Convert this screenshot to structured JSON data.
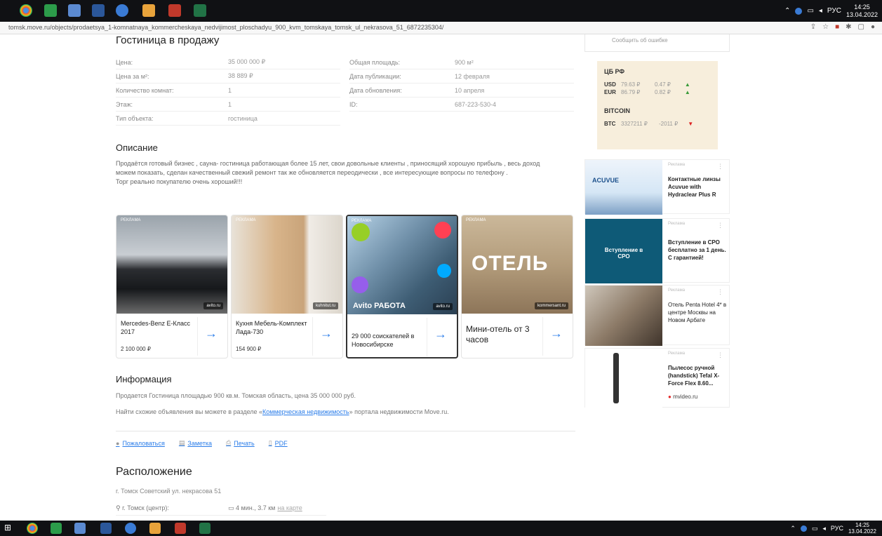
{
  "browser": {
    "url": "tomsk.move.ru/objects/prodaetsya_1-komnatnaya_kommercheskaya_nedvijimost_ploschadyu_900_kvm_tomskaya_tomsk_ul_nekrasova_51_6872235304/",
    "language": "РУС",
    "time": "14:25",
    "date": "13.04.2022"
  },
  "taskbar": {
    "language": "РУС",
    "time": "14:25",
    "date": "13.04.2022"
  },
  "listing": {
    "title": "Гостиница в продажу",
    "props_left": [
      {
        "label": "Цена:",
        "value": "35 000 000 ₽"
      },
      {
        "label": "Цена за м²:",
        "value": "38 889 ₽"
      },
      {
        "label": "Количество комнат:",
        "value": "1"
      },
      {
        "label": "Этаж:",
        "value": "1"
      },
      {
        "label": "Тип объекта:",
        "value": "гостиница"
      }
    ],
    "props_right": [
      {
        "label": "Общая площадь:",
        "value": "900 м²"
      },
      {
        "label": "Дата публикации:",
        "value": "12 февраля"
      },
      {
        "label": "Дата обновления:",
        "value": "10 апреля"
      },
      {
        "label": "ID:",
        "value": "687-223-530-4"
      }
    ],
    "description_title": "Описание",
    "description": "Продаётся готовый бизнес , сауна- гостиница работающая более 15 лет, свои довольные клиенты , приносящий хорошую прибыль , весь доход можем показать, сделан качественный свежий ремонт так же обновляется переодически , все интересующие вопросы по телефону .",
    "description_extra": "Торг реально покупателю очень хороший!!!"
  },
  "cards": [
    {
      "ad_label": "РЕКЛАМА",
      "source": "avito.ru",
      "caption": "Mercedes-Benz E-Класс 2017",
      "price": "2 100 000 ₽"
    },
    {
      "ad_label": "РЕКЛАМА",
      "source": "kuhnitut.ru",
      "caption": "Кухня Мебель-Комплект Лада-730",
      "price": "154 900 ₽"
    },
    {
      "ad_label": "РЕКЛАМА",
      "source": "avito.ru",
      "banner": "Avito РАБОТА",
      "caption": "29 000 соискателей в Новосибирске",
      "price": ""
    },
    {
      "ad_label": "РЕКЛАМА",
      "source": "kommersant.ru",
      "banner": "ОТЕЛЬ",
      "caption": "Мини-отель от 3 часов",
      "price": ""
    }
  ],
  "info": {
    "title": "Информация",
    "line1": "Продается Гостиница площадью 900 кв.м. Томская область, цена 35 000 000 руб.",
    "line2_before": "Найти схожие объявления вы можете в разделе «",
    "line2_link": "Коммерческая недвижимость",
    "line2_after": "» портала недвижимости Move.ru."
  },
  "actions": {
    "complain": "Пожаловаться",
    "note": "Заметка",
    "print": "Печать",
    "pdf": "PDF"
  },
  "location": {
    "title": "Расположение",
    "address": "г. Томск Советский ул. некрасова 51",
    "place": "г. Томск (центр):",
    "distance": "4 мин., 3.7 км",
    "map_link": "на карте"
  },
  "sidebar": {
    "top_text": "Сообщить об ошибке",
    "rates_title": "ЦБ РФ",
    "rates": [
      {
        "code": "USD",
        "value": "79.63 ₽",
        "delta": "0.47 ₽",
        "dir": "▲"
      },
      {
        "code": "EUR",
        "value": "86.79 ₽",
        "delta": "0.82 ₽",
        "dir": "▲"
      }
    ],
    "bitcoin_title": "BITCOIN",
    "btc": {
      "code": "BTC",
      "value": "3327211 ₽",
      "delta": "-2011 ₽",
      "dir": "▼"
    },
    "ads": [
      {
        "label": "Реклама",
        "text": "Контактные линзы Acuvue with Hydraclear Plus R",
        "brand": "ACUVUE"
      },
      {
        "label": "Реклама",
        "text": "Вступление в СРО бесплатно за 1 день. С гарантией!",
        "brand": "Вступление в СРО"
      },
      {
        "label": "Реклама",
        "text": "Отель Penta Hotel 4* в центре Москвы на Новом Арбате"
      },
      {
        "label": "Реклама",
        "text": "Пылесос ручной (handstick) Tefal X-Force Flex 8.60...",
        "source": "mvideo.ru"
      }
    ]
  },
  "colors": {
    "link": "#2b7de9",
    "rates_bg": "#f7eedc",
    "up": "#3a9b3a",
    "down": "#d22222"
  }
}
